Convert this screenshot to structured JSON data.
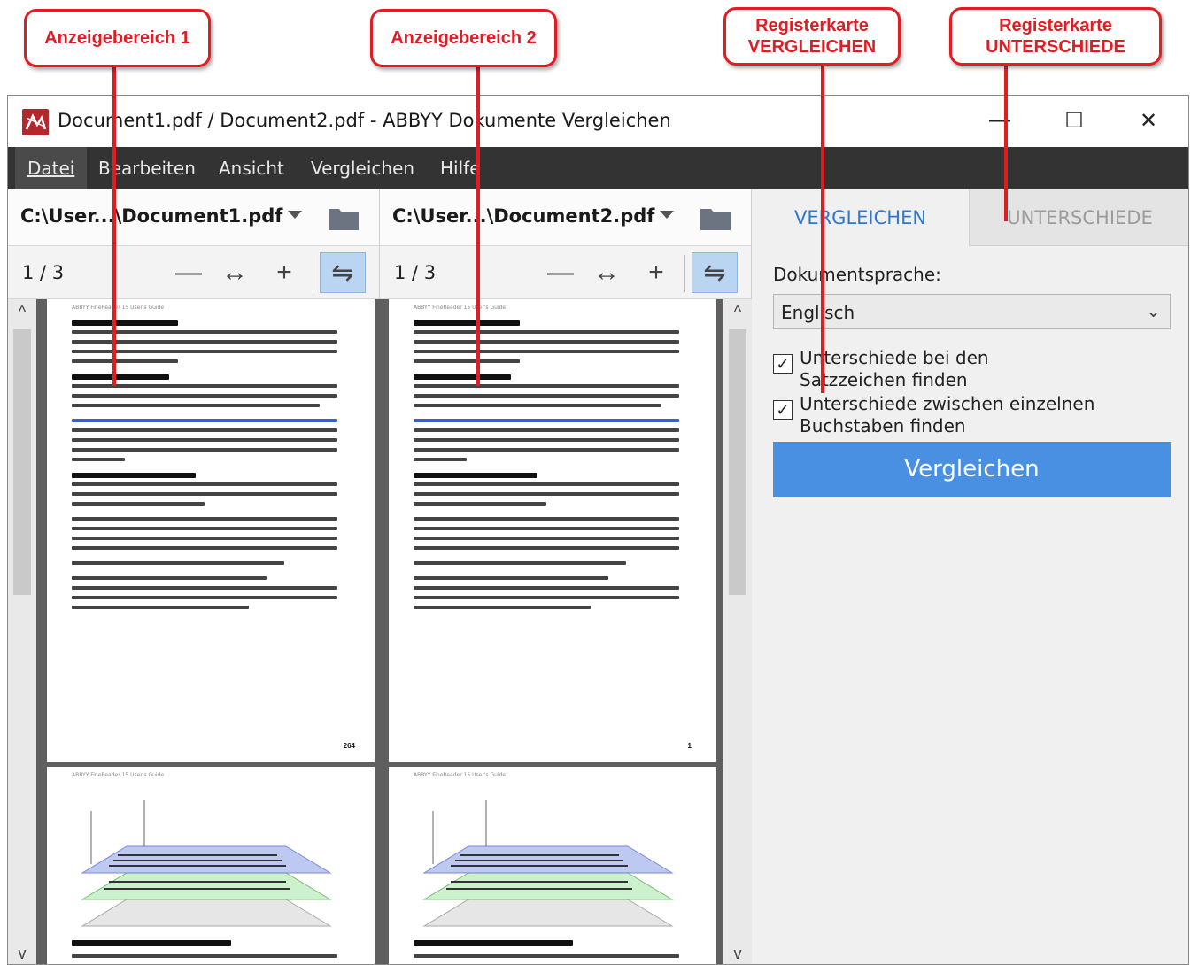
{
  "callouts": {
    "area1": "Anzeigebereich 1",
    "area2": "Anzeigebereich 2",
    "tab_compare_line1": "Registerkarte",
    "tab_compare_line2": "VERGLEICHEN",
    "tab_diff_line1": "Registerkarte",
    "tab_diff_line2": "UNTERSCHIEDE",
    "color": "#e31b23"
  },
  "window": {
    "title": "Document1.pdf / Document2.pdf - ABBYY Dokumente Vergleichen",
    "minimize": "—",
    "maximize": "☐",
    "close": "✕"
  },
  "menu": {
    "items": [
      "Datei",
      "Bearbeiten",
      "Ansicht",
      "Vergleichen",
      "Hilfe"
    ]
  },
  "pane1": {
    "path": "C:\\User...\\Document1.pdf",
    "page_indicator": "1 / 3",
    "page_header": "ABBYY FineReader 15 User's Guide",
    "page_number": "264"
  },
  "pane2": {
    "path": "C:\\User...\\Document2.pdf",
    "page_indicator": "1 / 3",
    "page_header": "ABBYY FineReader 15 User's Guide",
    "page_number": "1"
  },
  "toolbar": {
    "zoom_out": "—",
    "fit_width": "↔",
    "zoom_in": "+",
    "sync": "⇋"
  },
  "panel": {
    "tab_compare": "VERGLEICHEN",
    "tab_diff": "UNTERSCHIEDE",
    "lang_label": "Dokumentsprache:",
    "lang_value": "Englisch",
    "cb1_label": "Unterschiede bei den Satzzeichen finden",
    "cb1_checked": true,
    "cb2_label": "Unterschiede zwischen einzelnen Buchstaben finden",
    "cb2_checked": true,
    "compare_button": "Vergleichen",
    "accent": "#4a90e2",
    "tab_accent": "#2f78d2"
  }
}
